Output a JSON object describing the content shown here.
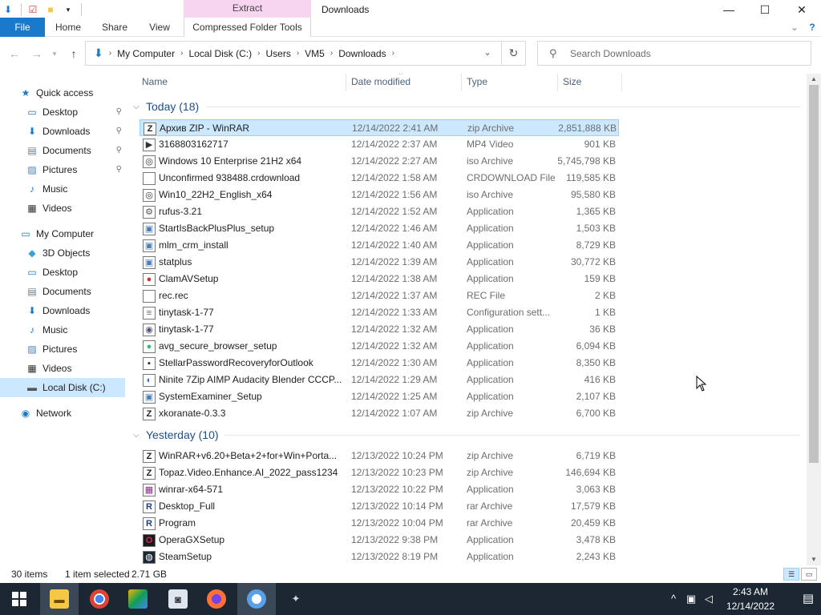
{
  "window": {
    "title": "Downloads",
    "context_tab": "Extract",
    "controls": {
      "minimize": "—",
      "maximize": "☐",
      "close": "✕"
    }
  },
  "ribbon": {
    "tabs": [
      "File",
      "Home",
      "Share",
      "View",
      "Compressed Folder Tools"
    ],
    "expand": "⌄",
    "help": "?"
  },
  "address": {
    "breadcrumbs": [
      "My Computer",
      "Local Disk (C:)",
      "Users",
      "VM5",
      "Downloads"
    ],
    "search_placeholder": "Search Downloads"
  },
  "nav": {
    "items": [
      {
        "label": "Quick access",
        "icon": "star-icon",
        "indent": 0,
        "pinned": false
      },
      {
        "label": "Desktop",
        "icon": "desktop-icon",
        "indent": 1,
        "pinned": true
      },
      {
        "label": "Downloads",
        "icon": "download-icon",
        "indent": 1,
        "pinned": true
      },
      {
        "label": "Documents",
        "icon": "document-icon",
        "indent": 1,
        "pinned": true
      },
      {
        "label": "Pictures",
        "icon": "pictures-icon",
        "indent": 1,
        "pinned": true
      },
      {
        "label": "Music",
        "icon": "music-icon",
        "indent": 1,
        "pinned": false
      },
      {
        "label": "Videos",
        "icon": "video-icon",
        "indent": 1,
        "pinned": false
      },
      {
        "label": "My Computer",
        "icon": "computer-icon",
        "indent": 0,
        "pinned": false
      },
      {
        "label": "3D Objects",
        "icon": "cube-icon",
        "indent": 1,
        "pinned": false
      },
      {
        "label": "Desktop",
        "icon": "desktop-icon",
        "indent": 1,
        "pinned": false
      },
      {
        "label": "Documents",
        "icon": "document-icon",
        "indent": 1,
        "pinned": false
      },
      {
        "label": "Downloads",
        "icon": "download-icon",
        "indent": 1,
        "pinned": false
      },
      {
        "label": "Music",
        "icon": "music-icon",
        "indent": 1,
        "pinned": false
      },
      {
        "label": "Pictures",
        "icon": "pictures-icon",
        "indent": 1,
        "pinned": false
      },
      {
        "label": "Videos",
        "icon": "video-icon",
        "indent": 1,
        "pinned": false
      },
      {
        "label": "Local Disk (C:)",
        "icon": "drive-icon",
        "indent": 1,
        "pinned": false,
        "selected": true
      },
      {
        "label": "Network",
        "icon": "network-icon",
        "indent": 0,
        "pinned": false
      }
    ]
  },
  "columns": [
    "Name",
    "Date modified",
    "Type",
    "Size"
  ],
  "groups": [
    {
      "label": "Today (18)",
      "files": [
        {
          "name": "Архив ZIP - WinRAR",
          "date": "12/14/2022 2:41 AM",
          "type": "zip Archive",
          "size": "2,851,888 KB",
          "icon": "zip-icon",
          "selected": true
        },
        {
          "name": "3168803162717",
          "date": "12/14/2022 2:37 AM",
          "type": "MP4 Video",
          "size": "901 KB",
          "icon": "video-file-icon"
        },
        {
          "name": "Windows 10 Enterprise 21H2 x64",
          "date": "12/14/2022 2:27 AM",
          "type": "iso Archive",
          "size": "5,745,798 KB",
          "icon": "iso-icon"
        },
        {
          "name": "Unconfirmed 938488.crdownload",
          "date": "12/14/2022 1:58 AM",
          "type": "CRDOWNLOAD File",
          "size": "119,585 KB",
          "icon": "blank-file-icon"
        },
        {
          "name": "Win10_22H2_English_x64",
          "date": "12/14/2022 1:56 AM",
          "type": "iso Archive",
          "size": "95,580 KB",
          "icon": "iso-icon"
        },
        {
          "name": "rufus-3.21",
          "date": "12/14/2022 1:52 AM",
          "type": "Application",
          "size": "1,365 KB",
          "icon": "rufus-icon"
        },
        {
          "name": "StartIsBackPlusPlus_setup",
          "date": "12/14/2022 1:46 AM",
          "type": "Application",
          "size": "1,503 KB",
          "icon": "installer-icon"
        },
        {
          "name": "mlm_crm_install",
          "date": "12/14/2022 1:40 AM",
          "type": "Application",
          "size": "8,729 KB",
          "icon": "installer-icon"
        },
        {
          "name": "statplus",
          "date": "12/14/2022 1:39 AM",
          "type": "Application",
          "size": "30,772 KB",
          "icon": "installer-icon"
        },
        {
          "name": "ClamAVSetup",
          "date": "12/14/2022 1:38 AM",
          "type": "Application",
          "size": "159 KB",
          "icon": "clamav-icon"
        },
        {
          "name": "rec.rec",
          "date": "12/14/2022 1:37 AM",
          "type": "REC File",
          "size": "2 KB",
          "icon": "blank-file-icon"
        },
        {
          "name": "tinytask-1-77",
          "date": "12/14/2022 1:33 AM",
          "type": "Configuration sett...",
          "size": "1 KB",
          "icon": "config-file-icon"
        },
        {
          "name": "tinytask-1-77",
          "date": "12/14/2022 1:32 AM",
          "type": "Application",
          "size": "36 KB",
          "icon": "tinytask-icon"
        },
        {
          "name": "avg_secure_browser_setup",
          "date": "12/14/2022 1:32 AM",
          "type": "Application",
          "size": "6,094 KB",
          "icon": "avg-icon"
        },
        {
          "name": "StellarPasswordRecoveryforOutlook",
          "date": "12/14/2022 1:30 AM",
          "type": "Application",
          "size": "8,350 KB",
          "icon": "stellar-icon"
        },
        {
          "name": "Ninite 7Zip AIMP Audacity Blender CCCP...",
          "date": "12/14/2022 1:29 AM",
          "type": "Application",
          "size": "416 KB",
          "icon": "ninite-icon"
        },
        {
          "name": "SystemExaminer_Setup",
          "date": "12/14/2022 1:25 AM",
          "type": "Application",
          "size": "2,107 KB",
          "icon": "installer-icon"
        },
        {
          "name": "xkoranate-0.3.3",
          "date": "12/14/2022 1:07 AM",
          "type": "zip Archive",
          "size": "6,700 KB",
          "icon": "zip-icon"
        }
      ]
    },
    {
      "label": "Yesterday (10)",
      "files": [
        {
          "name": "WinRAR+v6.20+Beta+2+for+Win+Porta...",
          "date": "12/13/2022 10:24 PM",
          "type": "zip Archive",
          "size": "6,719 KB",
          "icon": "zip-icon"
        },
        {
          "name": "Topaz.Video.Enhance.AI_2022_pass1234",
          "date": "12/13/2022 10:23 PM",
          "type": "zip Archive",
          "size": "146,694 KB",
          "icon": "zip-icon"
        },
        {
          "name": "winrar-x64-571",
          "date": "12/13/2022 10:22 PM",
          "type": "Application",
          "size": "3,063 KB",
          "icon": "winrar-icon"
        },
        {
          "name": "Desktop_Full",
          "date": "12/13/2022 10:14 PM",
          "type": "rar Archive",
          "size": "17,579 KB",
          "icon": "rar-icon"
        },
        {
          "name": "Program",
          "date": "12/13/2022 10:04 PM",
          "type": "rar Archive",
          "size": "20,459 KB",
          "icon": "rar-icon"
        },
        {
          "name": "OperaGXSetup",
          "date": "12/13/2022 9:38 PM",
          "type": "Application",
          "size": "3,478 KB",
          "icon": "opera-icon"
        },
        {
          "name": "SteamSetup",
          "date": "12/13/2022 8:19 PM",
          "type": "Application",
          "size": "2,243 KB",
          "icon": "steam-icon"
        }
      ]
    }
  ],
  "status": {
    "items": "30 items",
    "selected": "1 item selected",
    "size": "2.71 GB"
  },
  "taskbar": {
    "apps": [
      "start-icon",
      "file-explorer-icon",
      "chrome-icon",
      "app-icon",
      "disk-tool-icon",
      "firefox-icon",
      "browser-icon",
      "game-icon"
    ],
    "time": "2:43 AM",
    "date": "12/14/2022"
  },
  "colors": {
    "accent": "#1979ca",
    "selection": "#cce8ff",
    "extract_tab": "#f7d4ef",
    "taskbar": "#1c2733"
  }
}
